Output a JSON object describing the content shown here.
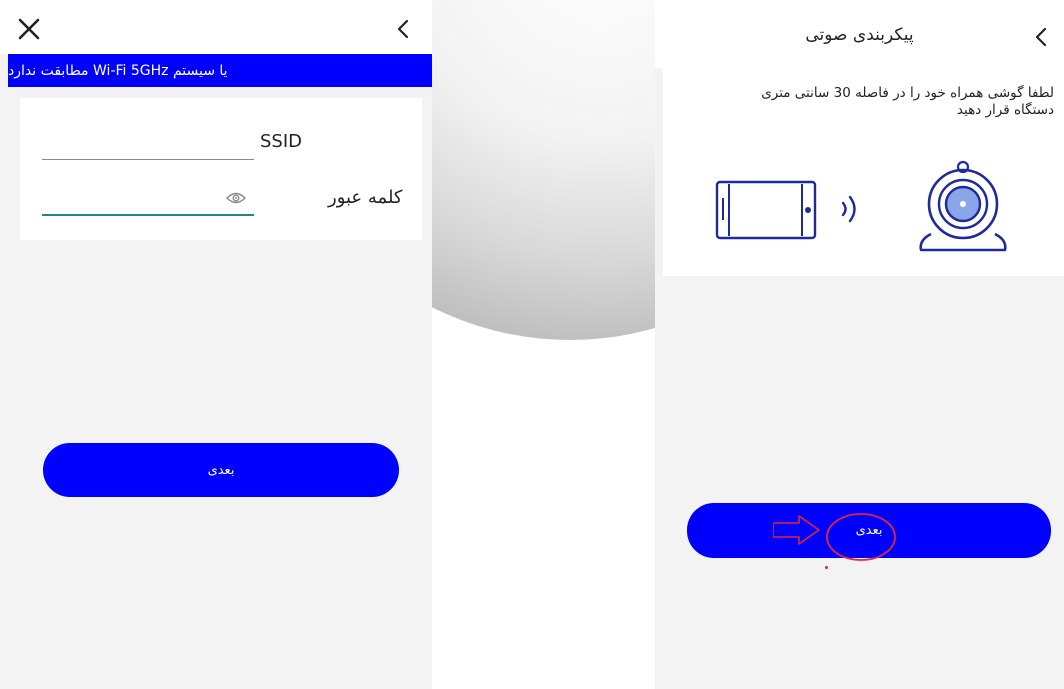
{
  "left_screen": {
    "close_icon": "close-icon",
    "back_icon": "chevron-left-icon",
    "banner_text": "یا سیستم Wi-Fi 5GHz مطابقت ندارد",
    "ssid_label": "SSID",
    "ssid_value": "",
    "password_label": "کلمه عبور",
    "password_value": "",
    "eye_icon": "eye-icon",
    "next_button": "بعدی"
  },
  "right_screen": {
    "back_icon": "chevron-left-icon",
    "title": "پیکربندی صوتی",
    "instruction": "لطفا گوشی همراه خود را در فاصله 30 سانتی متری دستگاه قرار دهید",
    "phone_icon": "phone-landscape-icon",
    "sound_icon": "sound-wave-icon",
    "camera_icon": "webcam-icon",
    "next_button": "بعدی",
    "annotation_arrow_icon": "red-arrow-icon",
    "annotation_circle": "red-circle-highlight"
  },
  "colors": {
    "brand_blue": "#0000ff",
    "icon_navy": "#1c2a9a",
    "focus_teal": "#1e8a7a",
    "annotation_red": "#e2263a",
    "background": "#f3f3f3"
  }
}
